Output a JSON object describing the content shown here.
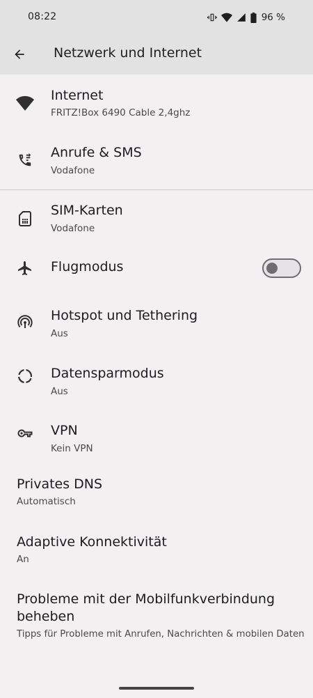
{
  "status_bar": {
    "time": "08:22",
    "battery_percent": "96 %",
    "icons": [
      "vibrate-icon",
      "wifi-icon",
      "signal-icon",
      "battery-icon"
    ]
  },
  "app_bar": {
    "title": "Netzwerk und Internet",
    "back_icon": "arrow-back-icon"
  },
  "items": {
    "internet": {
      "title": "Internet",
      "subtitle": "FRITZ!Box 6490 Cable 2,4ghz",
      "icon": "wifi-icon"
    },
    "calls": {
      "title": "Anrufe & SMS",
      "subtitle": "Vodafone",
      "icon": "phone-forward-icon"
    },
    "sim": {
      "title": "SIM-Karten",
      "subtitle": "Vodafone",
      "icon": "sim-card-icon"
    },
    "airplane": {
      "title": "Flugmodus",
      "icon": "airplane-icon",
      "enabled": false
    },
    "hotspot": {
      "title": "Hotspot und Tethering",
      "subtitle": "Aus",
      "icon": "hotspot-icon"
    },
    "datasaver": {
      "title": "Datensparmodus",
      "subtitle": "Aus",
      "icon": "data-saver-icon"
    },
    "vpn": {
      "title": "VPN",
      "subtitle": "Kein VPN",
      "icon": "key-icon"
    },
    "dns": {
      "title": "Privates DNS",
      "subtitle": "Automatisch"
    },
    "adaptive": {
      "title": "Adaptive Konnektivität",
      "subtitle": "An"
    },
    "troubleshoot": {
      "title": "Probleme mit der Mobilfunkverbindung beheben",
      "subtitle": "Tipps für Probleme mit Anrufen, Nachrichten & mobilen Daten"
    }
  },
  "colors": {
    "background": "#f2f0f1",
    "header": "#e2e2e2",
    "icon": "#303030",
    "toggle_off": "#6f6d72"
  }
}
